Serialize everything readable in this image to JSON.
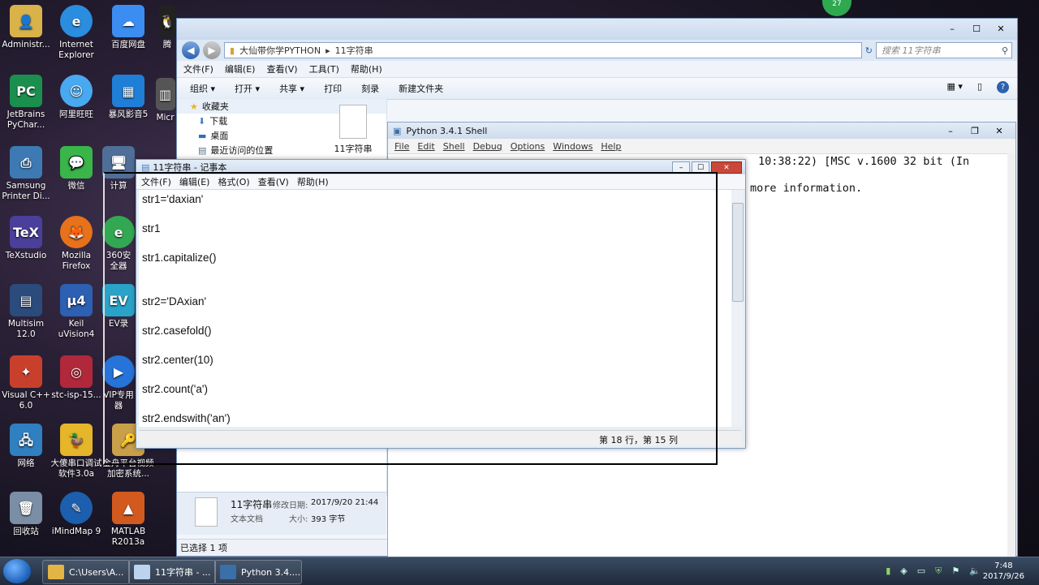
{
  "desktop": {
    "col1": [
      {
        "label": "Administr...",
        "icon": "user-folder-icon"
      },
      {
        "label": "JetBrains PyChar...",
        "icon": "pycharm-icon"
      },
      {
        "label": "Samsung Printer Di...",
        "icon": "printer-icon"
      },
      {
        "label": "TeXstudio",
        "icon": "texstudio-icon"
      },
      {
        "label": "Multisim 12.0",
        "icon": "multisim-icon"
      },
      {
        "label": "Visual C++ 6.0",
        "icon": "visual-cpp-icon"
      },
      {
        "label": "网络",
        "icon": "network-icon"
      },
      {
        "label": "回收站",
        "icon": "recycle-bin-icon"
      }
    ],
    "col2": [
      {
        "label": "Internet Explorer",
        "icon": "internet-explorer-icon"
      },
      {
        "label": "阿里旺旺",
        "icon": "aliwangwang-icon"
      },
      {
        "label": "微信",
        "icon": "wechat-icon"
      },
      {
        "label": "Mozilla Firefox",
        "icon": "firefox-icon"
      },
      {
        "label": "Keil uVision4",
        "icon": "keil-icon"
      },
      {
        "label": "stc-isp-15...",
        "icon": "stc-isp-icon"
      },
      {
        "label": "大傻串口调试软件3.0a",
        "icon": "serial-debug-icon"
      },
      {
        "label": "iMindMap 9",
        "icon": "imindmap-icon"
      }
    ],
    "col3": [
      {
        "label": "百度网盘",
        "icon": "baidu-netdisk-icon"
      },
      {
        "label": "暴风影音5",
        "icon": "baofeng-icon"
      },
      {
        "label": "计算",
        "icon": "computer-icon"
      },
      {
        "label": "360安全器",
        "icon": "360-security-icon"
      },
      {
        "label": "EV录",
        "icon": "ev-recorder-icon"
      },
      {
        "label": "VIP专用器",
        "icon": "vip-player-icon"
      },
      {
        "label": "金舟平台视频加密系统...",
        "icon": "video-encrypt-icon"
      },
      {
        "label": "MATLAB R2013a",
        "icon": "matlab-icon"
      }
    ],
    "partial": [
      {
        "label": "腾",
        "icon": "qq-icon"
      },
      {
        "label": "Micr",
        "icon": "microsoft-icon"
      }
    ],
    "badge": "27"
  },
  "explorer": {
    "path": [
      "大仙带你学PYTHON",
      "11字符串"
    ],
    "search_placeholder": "搜索 11字符串",
    "menu": [
      "文件(F)",
      "编辑(E)",
      "查看(V)",
      "工具(T)",
      "帮助(H)"
    ],
    "toolbar": [
      "组织 ▾",
      "打开 ▾",
      "共享 ▾",
      "打印",
      "刻录",
      "新建文件夹"
    ],
    "sidebar": [
      {
        "label": "收藏夹",
        "head": true
      },
      {
        "label": "下载"
      },
      {
        "label": "桌面"
      },
      {
        "label": "最近访问的位置"
      }
    ],
    "file_name": "11字符串",
    "details": {
      "name": "11字符串",
      "modified_label": "修改日期:",
      "modified": "2017/9/20 21:44",
      "type": "文本文档",
      "size_label": "大小:",
      "size": "393 字节"
    },
    "status": "已选择 1 项"
  },
  "shell": {
    "title": "Python 3.4.1 Shell",
    "menu": [
      "File",
      "Edit",
      "Shell",
      "Debug",
      "Options",
      "Windows",
      "Help"
    ],
    "line1": "10:38:22) [MSC v.1600 32 bit (In",
    "line2": "more information."
  },
  "notepad": {
    "title": "11字符串 - 记事本",
    "menu": [
      "文件(F)",
      "编辑(E)",
      "格式(O)",
      "查看(V)",
      "帮助(H)"
    ],
    "lines": [
      "str1='daxian'",
      "str1",
      "str1.capitalize()",
      "str2='DAxian'",
      "str2.casefold()",
      "str2.center(10)",
      "str2.count('a')",
      "str2.endswith('an')"
    ],
    "status": "第 18 行，第 15 列"
  },
  "taskbar": {
    "buttons": [
      "C:\\Users\\A...",
      "11字符串 - ...",
      "Python 3.4...."
    ],
    "time": "7:48",
    "date": "2017/9/26"
  }
}
